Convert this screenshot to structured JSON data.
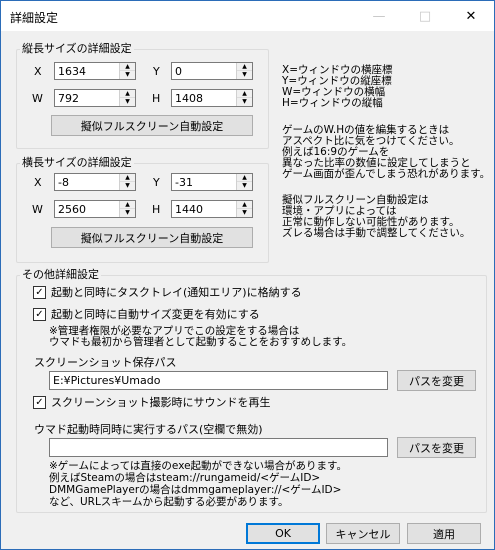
{
  "window": {
    "title": "詳細設定",
    "minimize_icon": "minimize-icon",
    "maximize_icon": "maximize-icon",
    "close_icon": "close-icon"
  },
  "vertical": {
    "group_label": "縦長サイズの詳細設定",
    "x_label": "X",
    "x_value": "1634",
    "y_label": "Y",
    "y_value": "0",
    "w_label": "W",
    "w_value": "792",
    "h_label": "H",
    "h_value": "1408",
    "fullscreen_button": "擬似フルスクリーン自動設定"
  },
  "horizontal": {
    "group_label": "横長サイズの詳細設定",
    "x_label": "X",
    "x_value": "-8",
    "y_label": "Y",
    "y_value": "-31",
    "w_label": "W",
    "w_value": "2560",
    "h_label": "H",
    "h_value": "1440",
    "fullscreen_button": "擬似フルスクリーン自動設定"
  },
  "help": {
    "legend": [
      "X=ウィンドウの横座標",
      "Y=ウィンドウの縦座標",
      "W=ウィンドウの横幅",
      "H=ウィンドウの縦幅"
    ],
    "aspect_note": [
      "ゲームのW.Hの値を編集するときは",
      "アスペクト比に気をつけてください。",
      "例えば16:9のゲームを",
      "異なった比率の数値に設定してしまうと",
      "ゲーム画面が歪んでしまう恐れがあります。"
    ],
    "fullscreen_note": [
      "擬似フルスクリーン自動設定は",
      "環境・アプリによっては",
      "正常に動作しない可能性があります。",
      "ズレる場合は手動で調整してください。"
    ]
  },
  "other": {
    "group_label": "その他詳細設定",
    "tray_checkbox": "起動と同時にタスクトレイ(通知エリア)に格納する",
    "tray_checked": true,
    "autosize_checkbox": "起動と同時に自動サイズ変更を有効にする",
    "autosize_checked": true,
    "admin_note": [
      "※管理者権限が必要なアプリでこの設定をする場合は",
      "ウマドも最初から管理者として起動することをおすすめします。"
    ],
    "screenshot_label": "スクリーンショット保存パス",
    "screenshot_path": "E:¥Pictures¥Umado",
    "change_path_button": "パスを変更",
    "sound_checkbox": "スクリーンショット撮影時にサウンドを再生",
    "sound_checked": true,
    "exec_label": "ウマド起動時同時に実行するパス(空欄で無効)",
    "exec_path": "",
    "exec_change_button": "パスを変更",
    "exec_note": [
      "※ゲームによっては直接のexe起動ができない場合があります。",
      "例えばSteamの場合はsteam://rungameid/<ゲームID>",
      "DMMGamePlayerの場合はdmmgameplayer://<ゲームID>",
      "など、URLスキームから起動する必要があります。"
    ]
  },
  "footer": {
    "ok_button": "OK",
    "cancel_button": "キャンセル",
    "apply_button": "適用"
  }
}
